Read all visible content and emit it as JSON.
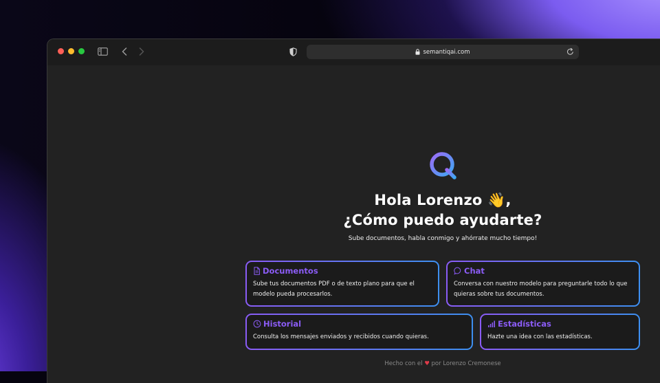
{
  "browser": {
    "url": "semantiqai.com"
  },
  "hero": {
    "greeting_line1": "Hola Lorenzo 👋,",
    "greeting_line2": "¿Cómo puedo ayudarte?",
    "subtitle": "Sube documentos, habla conmigo y ahórrate mucho tiempo!"
  },
  "cards": [
    {
      "title": "Documentos",
      "icon": "document-icon",
      "description": "Sube tus documentos PDF o de texto plano para que el modelo pueda procesarlos."
    },
    {
      "title": "Chat",
      "icon": "chat-bubble-icon",
      "description": "Conversa con nuestro modelo para preguntarle todo lo que quieras sobre tus documentos."
    },
    {
      "title": "Historial",
      "icon": "clock-icon",
      "description": "Consulta los mensajes enviados y recibidos cuando quieras."
    },
    {
      "title": "Estadísticas",
      "icon": "bar-chart-icon",
      "description": "Hazte una idea con las estadísticas."
    }
  ],
  "footer": {
    "prefix": "Hecho con el",
    "heart": "♥",
    "suffix": "por Lorenzo Cremonese"
  },
  "colors": {
    "accent": "#8b5cf6",
    "accent_blue": "#3d8ff0",
    "window_bg": "#222222"
  }
}
